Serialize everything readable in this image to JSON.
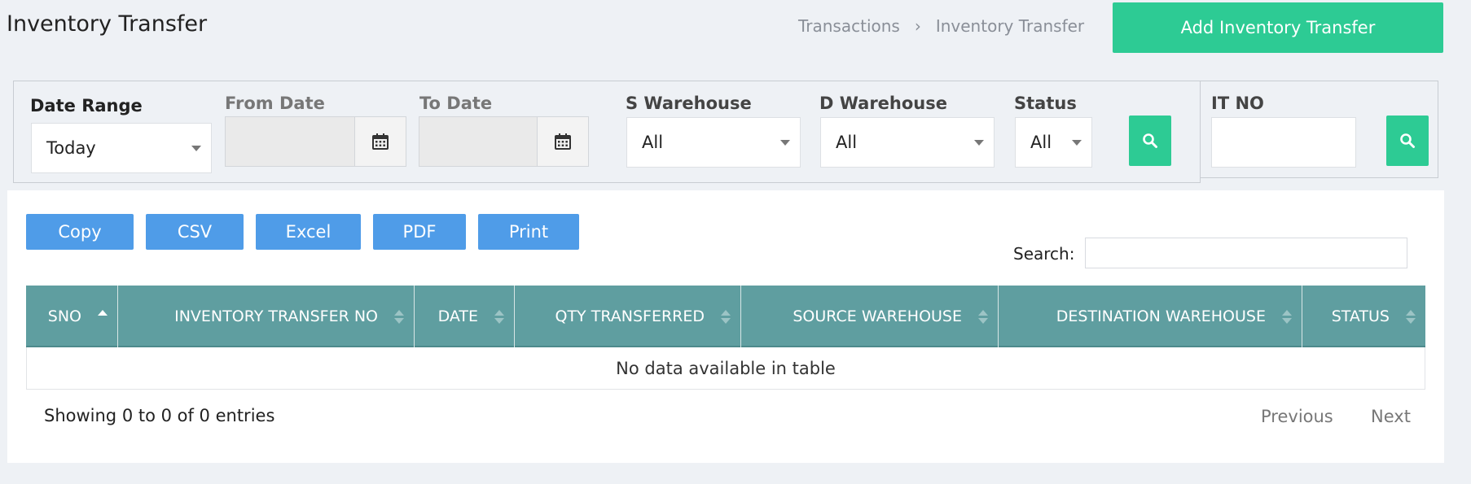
{
  "header": {
    "title": "Inventory Transfer",
    "breadcrumb": [
      "Transactions",
      "Inventory Transfer"
    ],
    "breadcrumb_sep": "›",
    "add_button": "Add Inventory Transfer"
  },
  "filters": {
    "date_range": {
      "label": "Date Range",
      "value": "Today"
    },
    "from_date": {
      "label": "From Date",
      "value": ""
    },
    "to_date": {
      "label": "To Date",
      "value": ""
    },
    "s_warehouse": {
      "label": "S Warehouse",
      "value": "All"
    },
    "d_warehouse": {
      "label": "D Warehouse",
      "value": "All"
    },
    "status": {
      "label": "Status",
      "value": "All"
    },
    "it_no": {
      "label": "IT NO",
      "value": ""
    }
  },
  "export_buttons": [
    "Copy",
    "CSV",
    "Excel",
    "PDF",
    "Print"
  ],
  "search": {
    "label": "Search:",
    "value": ""
  },
  "table": {
    "columns": [
      "SNO",
      "INVENTORY TRANSFER NO",
      "DATE",
      "QTY TRANSFERRED",
      "SOURCE WAREHOUSE",
      "DESTINATION WAREHOUSE",
      "STATUS"
    ],
    "empty_message": "No data available in table"
  },
  "footer": {
    "showing": "Showing 0 to 0 of 0 entries",
    "previous": "Previous",
    "next": "Next"
  },
  "colors": {
    "accent_green": "#2dcb94",
    "export_blue": "#4f9ce8",
    "table_header": "#5f9ea0"
  },
  "icons": [
    "calendar-icon",
    "search-icon",
    "sort-asc-icon",
    "sort-icon",
    "dropdown-caret-icon"
  ]
}
